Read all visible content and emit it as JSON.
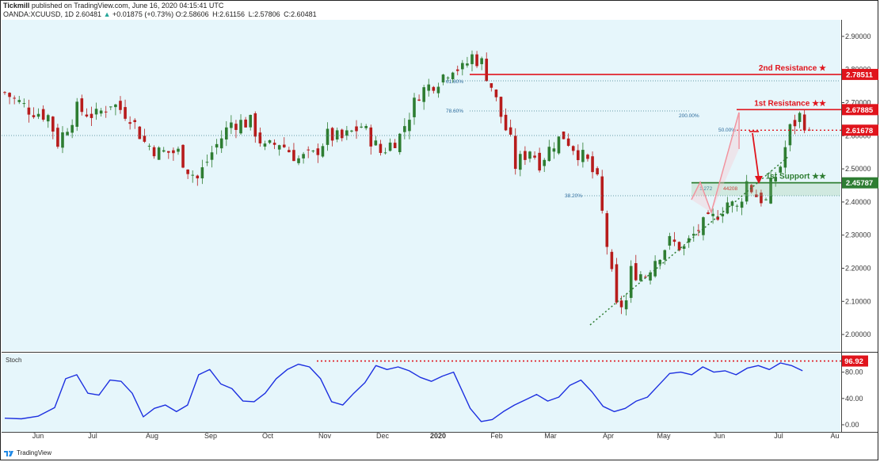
{
  "header": {
    "author": "Tickmill",
    "published_text": "published on TradingView.com, June 16, 2020 04:15:41 UTC",
    "symbol": "OANDA:XCUUSD, 1D",
    "last": "2.60481",
    "change_arrow": "▲",
    "change": "+0.01875 (+0.73%)",
    "o": "O:2.58606",
    "h": "H:2.61156",
    "l": "L:2.57806",
    "c": "C:2.60481"
  },
  "footer": {
    "brand": "TradingView"
  },
  "colors": {
    "plot_bg": "#e6f6fb",
    "bull": "#2e7d32",
    "bear": "#b71c1c",
    "resistance": "#e0141c",
    "support": "#2e7d32",
    "stoch": "#1c2fe0",
    "fib": "#2b6a9b"
  },
  "chart_data": {
    "type": "candlestick",
    "symbol": "OANDA:XCUUSD",
    "timeframe": "1D",
    "x_tick_labels": [
      "Jun",
      "Jul",
      "Aug",
      "Sep",
      "Oct",
      "Nov",
      "Dec",
      "2020",
      "Feb",
      "Mar",
      "Apr",
      "May",
      "Jun",
      "Jul",
      "Au"
    ],
    "y_tick_labels": [
      "2.90000",
      "2.80000",
      "2.70000",
      "2.60000",
      "2.50000",
      "2.40000",
      "2.30000",
      "2.20000",
      "2.10000",
      "2.00000"
    ],
    "ylim": [
      1.95,
      2.95
    ],
    "price_path": [
      [
        0,
        2.73
      ],
      [
        5,
        2.68
      ],
      [
        9,
        2.66
      ],
      [
        11,
        2.58
      ],
      [
        15,
        2.68
      ],
      [
        19,
        2.66
      ],
      [
        22,
        2.7
      ],
      [
        26,
        2.66
      ],
      [
        29,
        2.58
      ],
      [
        32,
        2.55
      ],
      [
        36,
        2.55
      ],
      [
        38,
        2.5
      ],
      [
        40,
        2.47
      ],
      [
        43,
        2.55
      ],
      [
        47,
        2.64
      ],
      [
        51,
        2.64
      ],
      [
        54,
        2.56
      ],
      [
        57,
        2.58
      ],
      [
        61,
        2.53
      ],
      [
        64,
        2.54
      ],
      [
        67,
        2.6
      ],
      [
        70,
        2.59
      ],
      [
        74,
        2.63
      ],
      [
        78,
        2.55
      ],
      [
        82,
        2.6
      ],
      [
        86,
        2.73
      ],
      [
        90,
        2.77
      ],
      [
        93,
        2.81
      ],
      [
        95,
        2.8
      ],
      [
        97,
        2.84
      ],
      [
        99,
        2.82
      ],
      [
        101,
        2.75
      ],
      [
        103,
        2.66
      ],
      [
        105,
        2.58
      ],
      [
        106,
        2.51
      ],
      [
        109,
        2.56
      ],
      [
        111,
        2.52
      ],
      [
        114,
        2.58
      ],
      [
        116,
        2.6
      ],
      [
        119,
        2.55
      ],
      [
        121,
        2.52
      ],
      [
        123,
        2.46
      ],
      [
        125,
        2.27
      ],
      [
        127,
        2.08
      ],
      [
        129,
        2.1
      ],
      [
        130,
        2.19
      ],
      [
        133,
        2.18
      ],
      [
        135,
        2.23
      ],
      [
        138,
        2.28
      ],
      [
        141,
        2.26
      ],
      [
        144,
        2.32
      ],
      [
        147,
        2.35
      ],
      [
        150,
        2.4
      ],
      [
        152,
        2.38
      ],
      [
        154,
        2.46
      ],
      [
        156,
        2.42
      ],
      [
        158,
        2.4
      ],
      [
        159,
        2.45
      ],
      [
        161,
        2.51
      ],
      [
        163,
        2.62
      ],
      [
        165,
        2.66
      ],
      [
        166,
        2.64
      ],
      [
        167,
        2.6
      ]
    ],
    "levels": [
      {
        "label": "2nd Resistance ★",
        "value": 2.78511,
        "value_text": "2.78511",
        "kind": "resistance"
      },
      {
        "label": "1st Resistance ★★",
        "value": 2.67885,
        "value_text": "2.67885",
        "kind": "resistance"
      },
      {
        "label": "",
        "value": 2.61678,
        "value_text": "2.61678",
        "kind": "resistance-dotted"
      },
      {
        "label": "1st Support ★★",
        "value": 2.45787,
        "value_text": "2.45787",
        "kind": "support"
      }
    ],
    "fib_labels": [
      "61.60%",
      "78.60%",
      "38.20%",
      "200.00%",
      "50.00%",
      "1.272",
      "44208"
    ],
    "stoch": {
      "title": "Stoch",
      "ylim": [
        0,
        100
      ],
      "y_tick_labels": [
        "80.00",
        "40.00",
        "0.00"
      ],
      "last_value": 96.92,
      "last_value_text": "96.92",
      "values": [
        [
          0,
          10
        ],
        [
          3,
          9
        ],
        [
          6,
          13
        ],
        [
          9,
          26
        ],
        [
          11,
          70
        ],
        [
          13,
          76
        ],
        [
          15,
          48
        ],
        [
          17,
          45
        ],
        [
          19,
          68
        ],
        [
          21,
          66
        ],
        [
          23,
          48
        ],
        [
          25,
          12
        ],
        [
          27,
          25
        ],
        [
          29,
          30
        ],
        [
          31,
          20
        ],
        [
          33,
          30
        ],
        [
          35,
          76
        ],
        [
          37,
          84
        ],
        [
          39,
          62
        ],
        [
          41,
          55
        ],
        [
          43,
          36
        ],
        [
          45,
          35
        ],
        [
          47,
          48
        ],
        [
          49,
          70
        ],
        [
          51,
          84
        ],
        [
          53,
          92
        ],
        [
          55,
          88
        ],
        [
          57,
          70
        ],
        [
          59,
          35
        ],
        [
          61,
          30
        ],
        [
          63,
          48
        ],
        [
          65,
          64
        ],
        [
          67,
          90
        ],
        [
          69,
          84
        ],
        [
          71,
          88
        ],
        [
          73,
          82
        ],
        [
          75,
          72
        ],
        [
          77,
          66
        ],
        [
          79,
          74
        ],
        [
          81,
          80
        ],
        [
          84,
          25
        ],
        [
          86,
          5
        ],
        [
          88,
          8
        ],
        [
          90,
          20
        ],
        [
          92,
          30
        ],
        [
          94,
          38
        ],
        [
          96,
          46
        ],
        [
          98,
          36
        ],
        [
          100,
          42
        ],
        [
          102,
          60
        ],
        [
          104,
          68
        ],
        [
          106,
          50
        ],
        [
          108,
          28
        ],
        [
          110,
          20
        ],
        [
          112,
          25
        ],
        [
          114,
          36
        ],
        [
          116,
          42
        ],
        [
          118,
          60
        ],
        [
          120,
          78
        ],
        [
          122,
          80
        ],
        [
          124,
          76
        ],
        [
          126,
          88
        ],
        [
          128,
          80
        ],
        [
          130,
          82
        ],
        [
          132,
          76
        ],
        [
          134,
          86
        ],
        [
          136,
          90
        ],
        [
          138,
          84
        ],
        [
          140,
          94
        ],
        [
          142,
          90
        ],
        [
          144,
          82
        ]
      ]
    }
  }
}
